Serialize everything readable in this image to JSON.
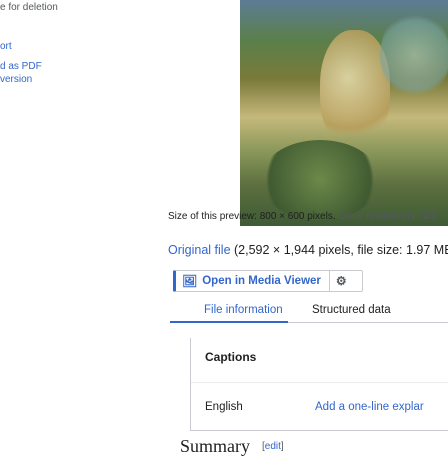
{
  "sidebar": {
    "line1": "e for deletion",
    "line2": "ort",
    "line3": "d as PDF",
    "line4": "version"
  },
  "preview": {
    "size_text": "Size of this preview: 800 × 600 pixels.",
    "other_text": "Other resolutions: 320"
  },
  "original": {
    "link_label": "Original file",
    "details": "(2,592 × 1,944 pixels, file size: 1.97 MB"
  },
  "media_viewer": {
    "label": "Open in Media Viewer",
    "icon": "image-icon",
    "settings_icon": "gear-icon"
  },
  "tabs": [
    {
      "label": "File information",
      "active": true
    },
    {
      "label": "Structured data",
      "active": false
    }
  ],
  "captions": {
    "title": "Captions",
    "language": "English",
    "placeholder": "Add a one-line explar"
  },
  "summary": {
    "title": "Summary",
    "edit_open": "[",
    "edit_label": "edit",
    "edit_close": "]"
  },
  "colors": {
    "link": "#3366cc",
    "border": "#c8ccd1"
  }
}
